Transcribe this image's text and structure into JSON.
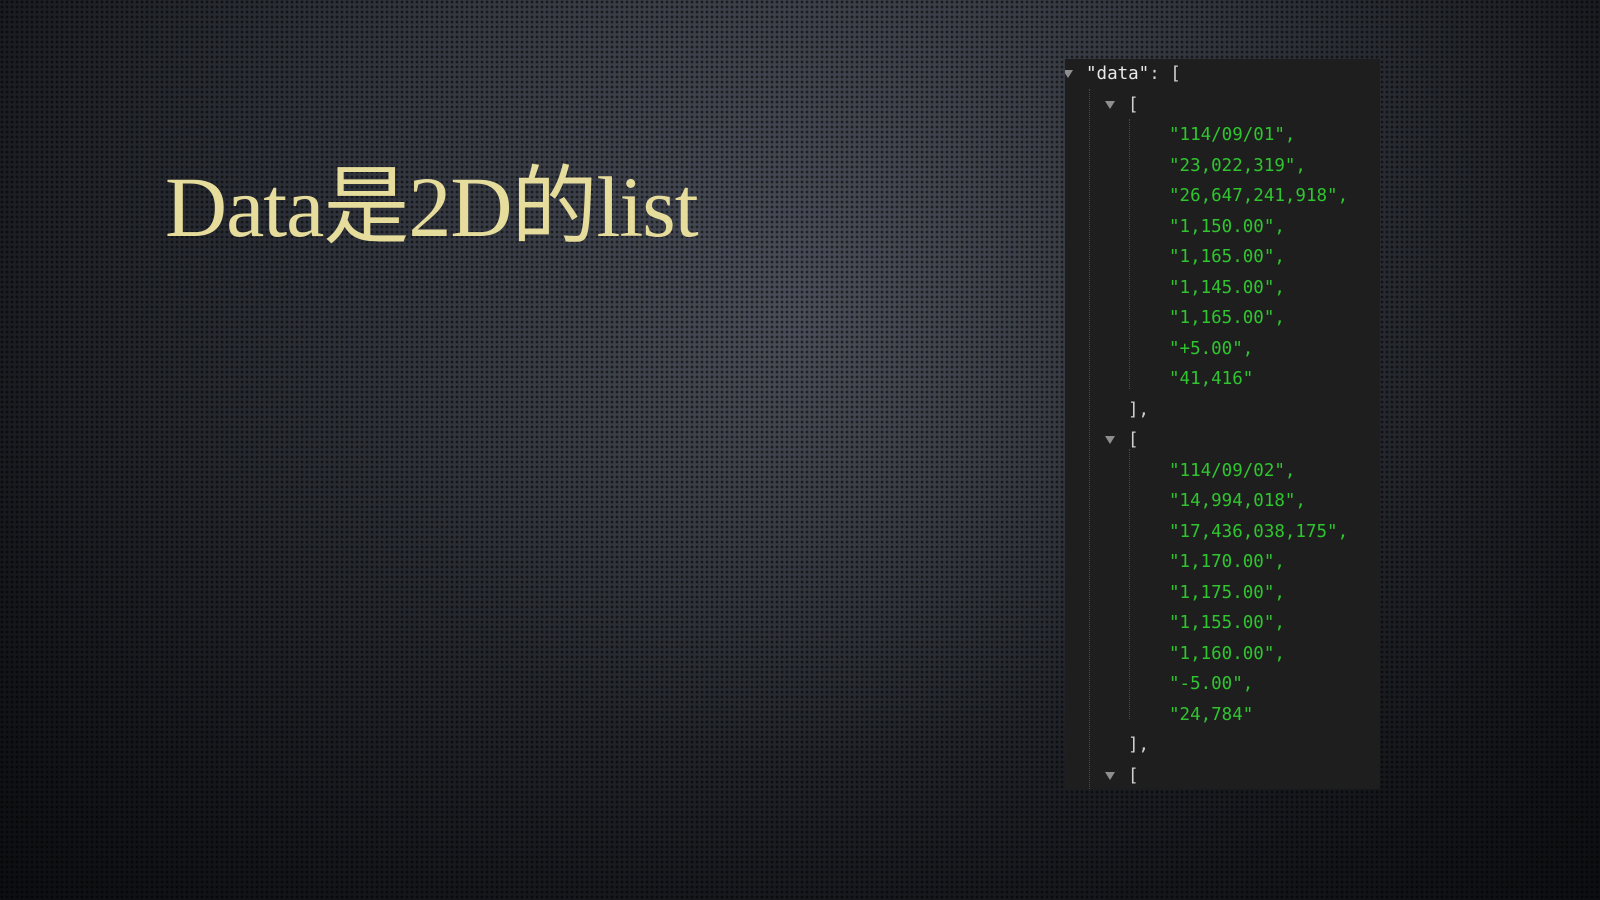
{
  "slide": {
    "title": "Data是2D的list"
  },
  "json_view": {
    "key": "\"data\"",
    "colon_open": ": [",
    "open_bracket": "[",
    "close_bracket": "],",
    "arrays": [
      {
        "values": [
          "\"114/09/01\",",
          "\"23,022,319\",",
          "\"26,647,241,918\",",
          "\"1,150.00\",",
          "\"1,165.00\",",
          "\"1,145.00\",",
          "\"1,165.00\",",
          "\"+5.00\",",
          "\"41,416\""
        ]
      },
      {
        "values": [
          "\"114/09/02\",",
          "\"14,994,018\",",
          "\"17,436,038,175\",",
          "\"1,170.00\",",
          "\"1,175.00\",",
          "\"1,155.00\",",
          "\"1,160.00\",",
          "\"-5.00\",",
          "\"24,784\""
        ]
      }
    ]
  }
}
